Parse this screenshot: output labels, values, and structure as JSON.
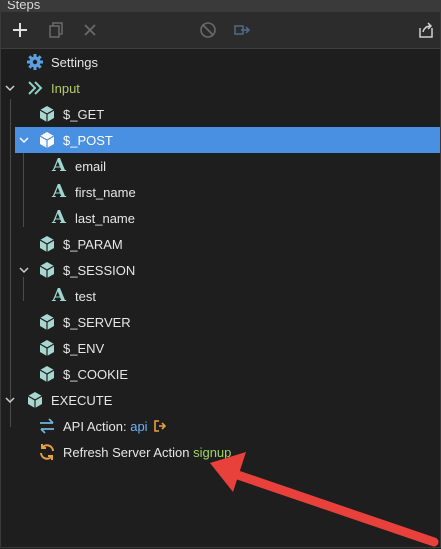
{
  "header": {
    "title": "Steps"
  },
  "toolbar": {
    "buttons": [
      "plus-icon",
      "copy-icon",
      "close-icon",
      "disable-icon",
      "move-icon",
      "export-icon"
    ]
  },
  "tree": {
    "settings": "Settings",
    "input": "Input",
    "get": "$_GET",
    "post": "$_POST",
    "email": "email",
    "first_name": "first_name",
    "last_name": "last_name",
    "param": "$_PARAM",
    "session": "$_SESSION",
    "test": "test",
    "server": "$_SERVER",
    "env": "$_ENV",
    "cookie": "$_COOKIE",
    "execute": "EXECUTE",
    "api_action_label": "API Action:",
    "api_action_value": "api",
    "refresh_label": "Refresh Server Action",
    "refresh_value": "signup"
  },
  "colors": {
    "selected_row": "#4a90e2",
    "cube": "#a7d7cf",
    "annotation_arrow": "#e8403a"
  }
}
